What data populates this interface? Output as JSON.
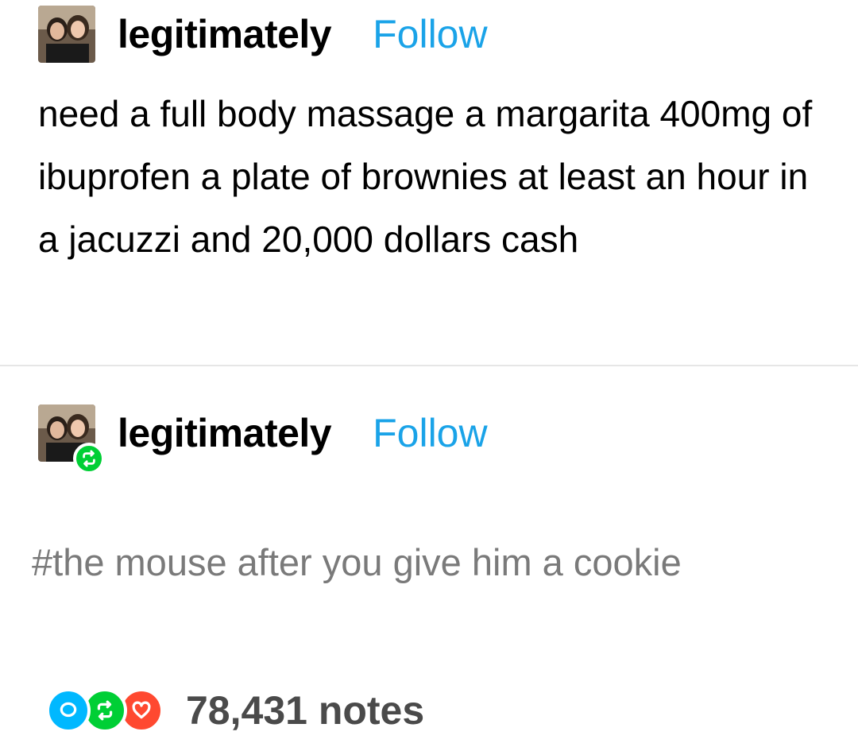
{
  "posts": [
    {
      "username": "legitimately",
      "follow_label": "Follow",
      "avatar_icon": "user-avatar-photo",
      "body": "need a full body massage a margarita 400mg of ibuprofen a plate of brownies at least an hour in a jacuzzi and 20,000 dollars cash"
    },
    {
      "username": "legitimately",
      "follow_label": "Follow",
      "avatar_icon": "user-avatar-photo",
      "badge_icon": "reblog-icon",
      "tags": "#the mouse after you give him a cookie"
    }
  ],
  "notes": {
    "count_label": "78,431 notes",
    "icons": [
      "reply-icon",
      "reblog-icon",
      "heart-icon"
    ]
  },
  "colors": {
    "follow": "#1aa3e8",
    "tag_text": "#7a7a7a",
    "reply": "#00b8ff",
    "reblog": "#00cf35",
    "like": "#ff4930",
    "notes_text": "#4a4a4a"
  }
}
